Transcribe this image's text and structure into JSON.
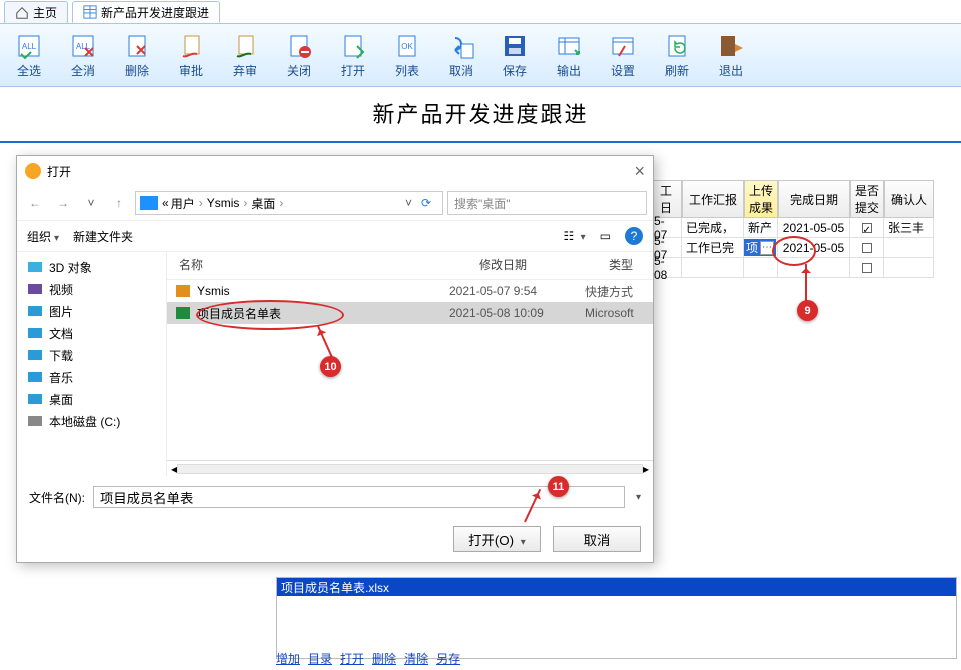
{
  "tabs": {
    "home": "主页",
    "active": "新产品开发进度跟进"
  },
  "toolbar": [
    {
      "key": "select-all",
      "label": "全选"
    },
    {
      "key": "clear-all",
      "label": "全消"
    },
    {
      "key": "delete",
      "label": "删除"
    },
    {
      "key": "approve",
      "label": "审批"
    },
    {
      "key": "abandon",
      "label": "弃审"
    },
    {
      "key": "close",
      "label": "关闭"
    },
    {
      "key": "open",
      "label": "打开"
    },
    {
      "key": "list",
      "label": "列表"
    },
    {
      "key": "cancel",
      "label": "取消"
    },
    {
      "key": "save",
      "label": "保存"
    },
    {
      "key": "export",
      "label": "输出"
    },
    {
      "key": "settings",
      "label": "设置"
    },
    {
      "key": "refresh",
      "label": "刷新"
    },
    {
      "key": "exit",
      "label": "退出"
    }
  ],
  "page_title": "新产品开发进度跟进",
  "grid": {
    "headers": {
      "date_trunc": "工日",
      "report": "工作汇报",
      "upload": "上传\n成果",
      "finish_date": "完成日期",
      "submitted": "是否\n提交",
      "confirmer": "确认人"
    },
    "rows": [
      {
        "date_trunc": "5-07",
        "report": "已完成，",
        "upload": "新产",
        "finish": "2021-05-05",
        "submitted": true,
        "confirmer": "张三丰"
      },
      {
        "date_trunc": "5-07",
        "report": "工作已完",
        "upload_sel": "项",
        "finish": "2021-05-05",
        "submitted": false,
        "confirmer": ""
      },
      {
        "date_trunc": "5-08",
        "report": "",
        "upload": "",
        "finish": "",
        "submitted": false,
        "confirmer": ""
      }
    ]
  },
  "dialog": {
    "title": "打开",
    "breadcrumb": {
      "prefix": "«",
      "parts": [
        "用户",
        "Ysmis",
        "桌面"
      ]
    },
    "search_placeholder": "搜索\"桌面\"",
    "organise": "组织",
    "new_folder": "新建文件夹",
    "nav": [
      {
        "key": "3d",
        "label": "3D 对象"
      },
      {
        "key": "video",
        "label": "视频"
      },
      {
        "key": "image",
        "label": "图片"
      },
      {
        "key": "docs",
        "label": "文档"
      },
      {
        "key": "dl",
        "label": "下载"
      },
      {
        "key": "music",
        "label": "音乐"
      },
      {
        "key": "desk",
        "label": "桌面"
      },
      {
        "key": "cdisk",
        "label": "本地磁盘 (C:)"
      }
    ],
    "file_head": {
      "name": "名称",
      "date": "修改日期",
      "type": "类型"
    },
    "files": [
      {
        "name": "Ysmis",
        "date": "2021-05-07 9:54",
        "type": "快捷方式",
        "icon": "shortcut",
        "selected": false
      },
      {
        "name": "项目成员名单表",
        "date": "2021-05-08 10:09",
        "type": "Microsoft",
        "icon": "excel",
        "selected": true
      }
    ],
    "file_name_label": "文件名(N):",
    "file_name_value": "项目成员名单表",
    "open_btn": "打开(O)",
    "cancel_btn": "取消"
  },
  "preview": {
    "filename": "项目成员名单表.xlsx"
  },
  "action_links": [
    "增加",
    "目录",
    "打开",
    "删除",
    "清除",
    "另存"
  ],
  "callouts": {
    "c9": "9",
    "c10": "10",
    "c11": "11"
  }
}
